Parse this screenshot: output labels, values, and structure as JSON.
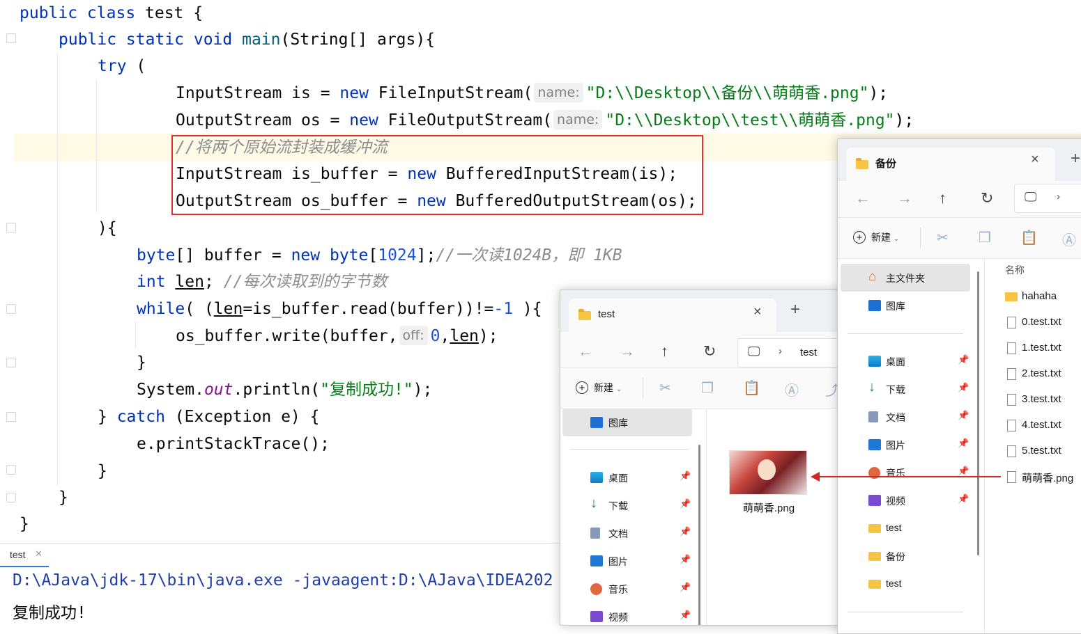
{
  "editor": {
    "hints": {
      "name": "name:",
      "off": "off:"
    },
    "lines": {
      "l1": {
        "a": "public class",
        "b": " test {"
      },
      "l2": {
        "a": "public static void",
        "b": "main",
        "c": "(String[] args){"
      },
      "l3": {
        "a": "try",
        "b": " ("
      },
      "l4": {
        "a": "InputStream is = ",
        "b": "new",
        "c": " FileInputStream(",
        "d": "\"D:\\\\Desktop\\\\备份\\\\萌萌香.png\"",
        "e": ");"
      },
      "l5": {
        "a": "OutputStream os = ",
        "b": "new",
        "c": " FileOutputStream(",
        "d": "\"D:\\\\Desktop\\\\test\\\\萌萌香.png\"",
        "e": ");"
      },
      "l6": {
        "a": "//将两个原始流封装成缓冲流"
      },
      "l7": {
        "a": "InputStream is_buffer = ",
        "b": "new",
        "c": " BufferedInputStream(is);"
      },
      "l8": {
        "a": "OutputStream os_buffer = ",
        "b": "new",
        "c": " BufferedOutputStream(os);"
      },
      "l9": {
        "a": "){"
      },
      "l10": {
        "a": "byte",
        "b": "[] buffer = ",
        "c": "new",
        "d": " ",
        "e": "byte",
        "f": "[",
        "g": "1024",
        "h": "];",
        "i": "//一次读1024B，即 1KB"
      },
      "l11": {
        "a": "int",
        "b": " ",
        "c": "len",
        "d": "; ",
        "e": "//每次读取到的字节数"
      },
      "l12": {
        "a": "while",
        "b": "( (",
        "c": "len",
        "d": "=is_buffer.read(buffer))!=",
        "e": "-1",
        "f": " ){"
      },
      "l13": {
        "a": "os_buffer.write(buffer,",
        "b": "0",
        "c": ",",
        "d": "len",
        "e": ");"
      },
      "l14": {
        "a": "}"
      },
      "l15": {
        "a": "System.",
        "b": "out",
        "c": ".println(",
        "d": "\"复制成功!\"",
        "e": ");"
      },
      "l16": {
        "a": "} ",
        "b": "catch",
        "c": " (Exception e) {"
      },
      "l17": {
        "a": "e.printStackTrace();"
      },
      "l18": {
        "a": "}"
      },
      "l19": {
        "a": "}"
      },
      "l20": {
        "a": "}"
      }
    }
  },
  "run_panel": {
    "tab_label": "test",
    "close_glyph": "✕",
    "command": "D:\\AJava\\jdk-17\\bin\\java.exe -javaagent:D:\\AJava\\IDEA202",
    "output": "复制成功!"
  },
  "explorer_test": {
    "tab_title": "test",
    "address": "test",
    "new_label": "新建",
    "sidebar": {
      "gallery": "图库",
      "desktop": "桌面",
      "downloads": "下载",
      "documents": "文档",
      "pictures": "图片",
      "music": "音乐",
      "videos": "视频"
    },
    "file": "萌萌香.png"
  },
  "explorer_backup": {
    "tab_title": "备份",
    "new_label": "新建",
    "column_name": "名称",
    "sidebar": {
      "home": "主文件夹",
      "gallery": "图库",
      "desktop": "桌面",
      "downloads": "下载",
      "documents": "文档",
      "pictures": "图片",
      "music": "音乐",
      "videos": "视频",
      "test1": "test",
      "backup": "备份",
      "test2": "test"
    },
    "files": [
      "hahaha",
      "0.test.txt",
      "1.test.txt",
      "2.test.txt",
      "3.test.txt",
      "4.test.txt",
      "5.test.txt",
      "萌萌香.png"
    ]
  },
  "colors": {
    "keyword": "#0033b3",
    "string": "#067d17",
    "number": "#1750eb",
    "comment": "#8c8c8c",
    "highlight_box": "#e03232",
    "arrow": "#d42424"
  }
}
